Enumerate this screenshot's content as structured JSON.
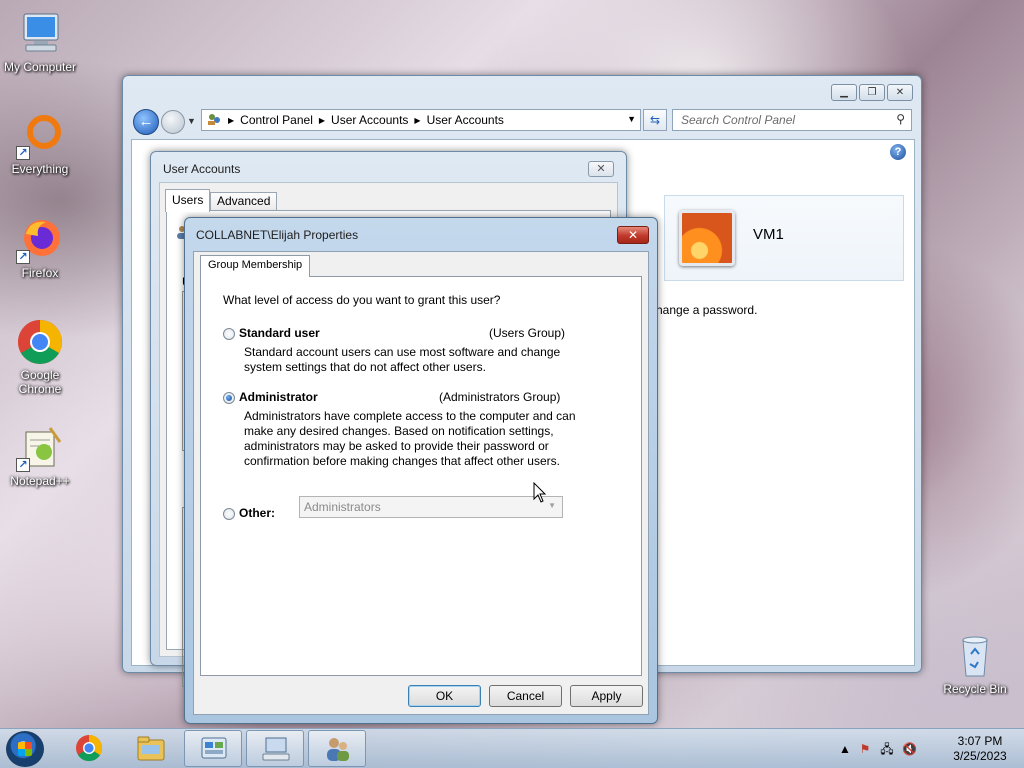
{
  "desktop": {
    "icons": [
      {
        "label": "My Computer"
      },
      {
        "label": "Everything"
      },
      {
        "label": "Firefox"
      },
      {
        "label": "Google Chrome"
      },
      {
        "label": "Notepad++"
      },
      {
        "label": "Recycle Bin"
      }
    ]
  },
  "control_panel": {
    "breadcrumbs": [
      "Control Panel",
      "User Accounts",
      "User Accounts"
    ],
    "search_placeholder": "Search Control Panel",
    "user_card_name": "VM1",
    "partial_text": "hange a password."
  },
  "user_accounts_dialog": {
    "title": "User Accounts",
    "tabs": [
      "Users",
      "Advanced"
    ],
    "partial_label": "U"
  },
  "properties_dialog": {
    "title": "COLLABNET\\Elijah Properties",
    "tab": "Group Membership",
    "question": "What level of access do you want to grant this user?",
    "options": [
      {
        "label": "Standard user",
        "group": "(Users Group)",
        "description": "Standard account users can use most software and change system settings that do not affect other users.",
        "selected": false
      },
      {
        "label": "Administrator",
        "group": "(Administrators Group)",
        "description": "Administrators have complete access to the computer and can make any desired changes. Based on notification settings, administrators may be asked to provide their password or confirmation before making changes that affect other users.",
        "selected": true
      },
      {
        "label": "Other:",
        "selected": false
      }
    ],
    "other_select_value": "Administrators",
    "buttons": {
      "ok": "OK",
      "cancel": "Cancel",
      "apply": "Apply"
    }
  },
  "taskbar": {
    "time": "3:07 PM",
    "date": "3/25/2023"
  }
}
